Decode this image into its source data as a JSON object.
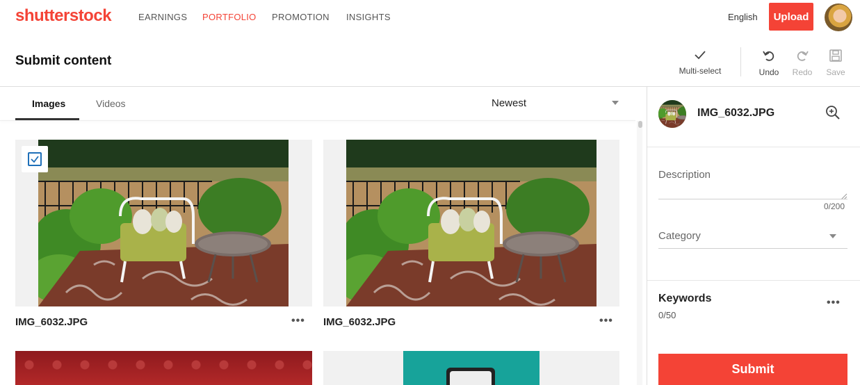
{
  "brand": {
    "logo_text": "shutterstock",
    "accent": "#f44336"
  },
  "nav": {
    "items": [
      {
        "label": "EARNINGS",
        "active": false
      },
      {
        "label": "PORTFOLIO",
        "active": true
      },
      {
        "label": "PROMOTION",
        "active": false
      },
      {
        "label": "INSIGHTS",
        "active": false
      }
    ],
    "language": "English",
    "upload_label": "Upload"
  },
  "header": {
    "title": "Submit content",
    "tools": [
      {
        "label": "Multi-select",
        "icon": "check-icon",
        "enabled": true
      },
      {
        "label": "Undo",
        "icon": "undo-icon",
        "enabled": true
      },
      {
        "label": "Redo",
        "icon": "redo-icon",
        "enabled": false
      },
      {
        "label": "Save",
        "icon": "save-icon",
        "enabled": false
      }
    ]
  },
  "tabs": {
    "items": [
      "Images",
      "Videos"
    ],
    "active": "Images"
  },
  "sort": {
    "selected": "Newest"
  },
  "gallery": {
    "items": [
      {
        "filename": "IMG_6032.JPG",
        "selected": true
      },
      {
        "filename": "IMG_6032.JPG",
        "selected": false
      }
    ],
    "more_label": "•••"
  },
  "details": {
    "filename": "IMG_6032.JPG",
    "description_label": "Description",
    "description_counter": "0/200",
    "category_label": "Category",
    "keywords_label": "Keywords",
    "keywords_counter": "0/50",
    "keywords_more": "•••",
    "submit_label": "Submit"
  }
}
